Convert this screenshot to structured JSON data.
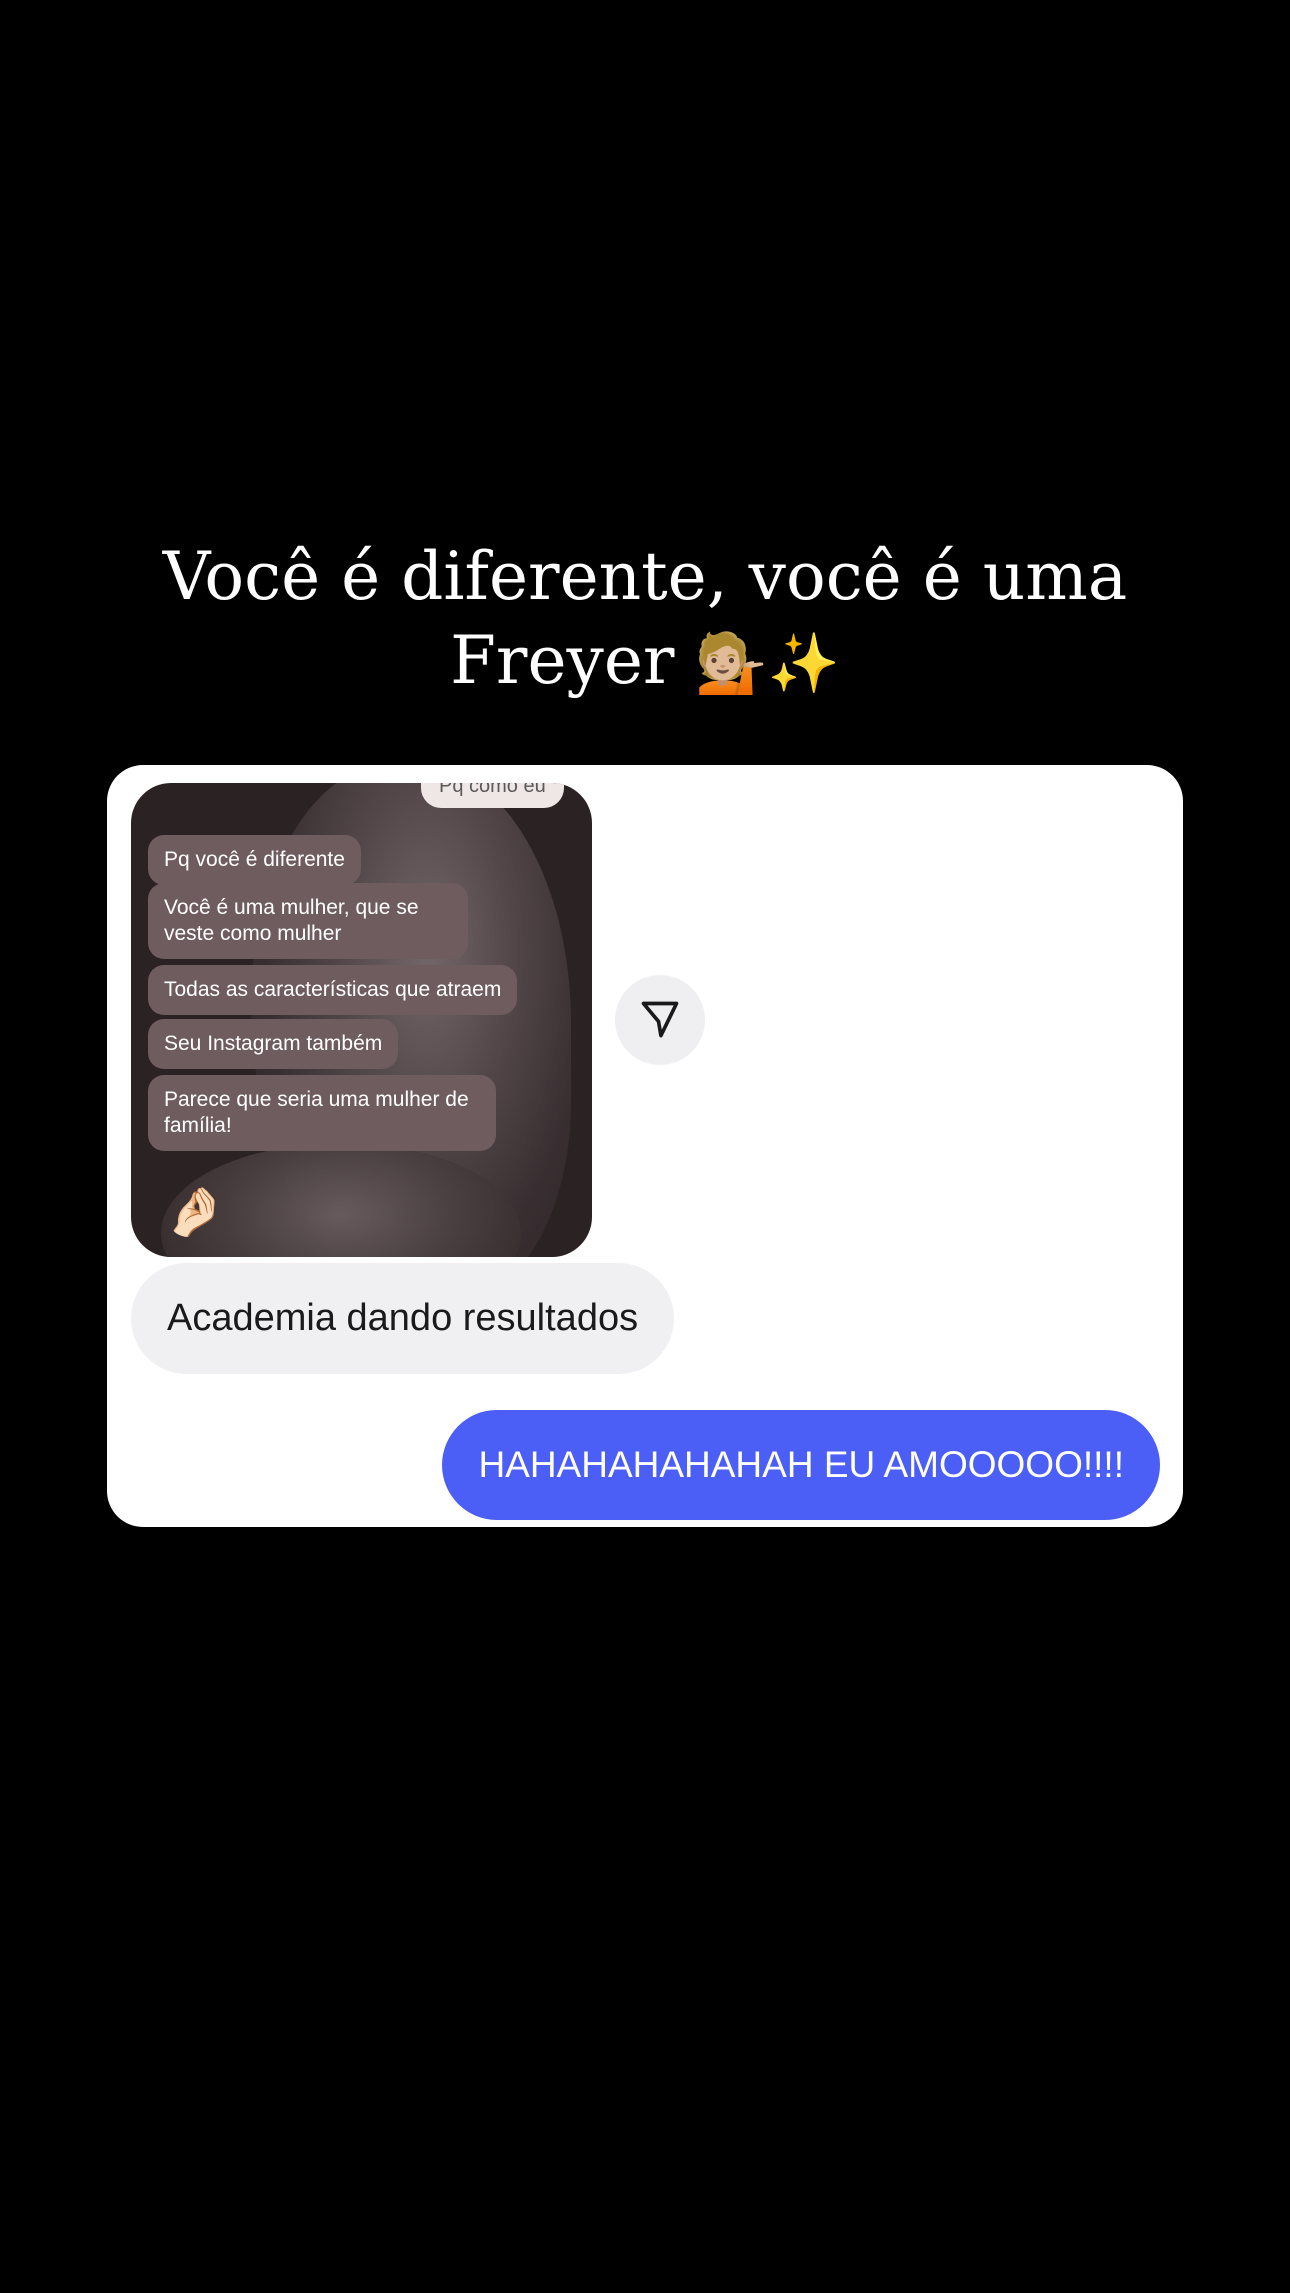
{
  "story": {
    "caption_line1": "Você é diferente, você é uma",
    "caption_line2": "Freyer",
    "caption_emojis": "💁🏼✨"
  },
  "chat": {
    "shared_image": {
      "top_bubble": "Pq como eu",
      "messages": [
        "Pq você é diferente",
        "Você é uma mulher, que se veste como mulher",
        "Todas as características que atraem",
        "Seu Instagram também",
        "Parece que seria uma mulher de família!"
      ],
      "reaction_emoji": "🤌🏻"
    },
    "share_icon": "send-icon",
    "received_message": "Academia dando resultados",
    "sent_message": "HAHAHAHAHAHAH EU AMOOOOO!!!!",
    "colors": {
      "sent_bubble": "#4b5ef6",
      "received_bubble": "#f0f0f2",
      "inner_bubble": "#6e5c5f"
    }
  }
}
